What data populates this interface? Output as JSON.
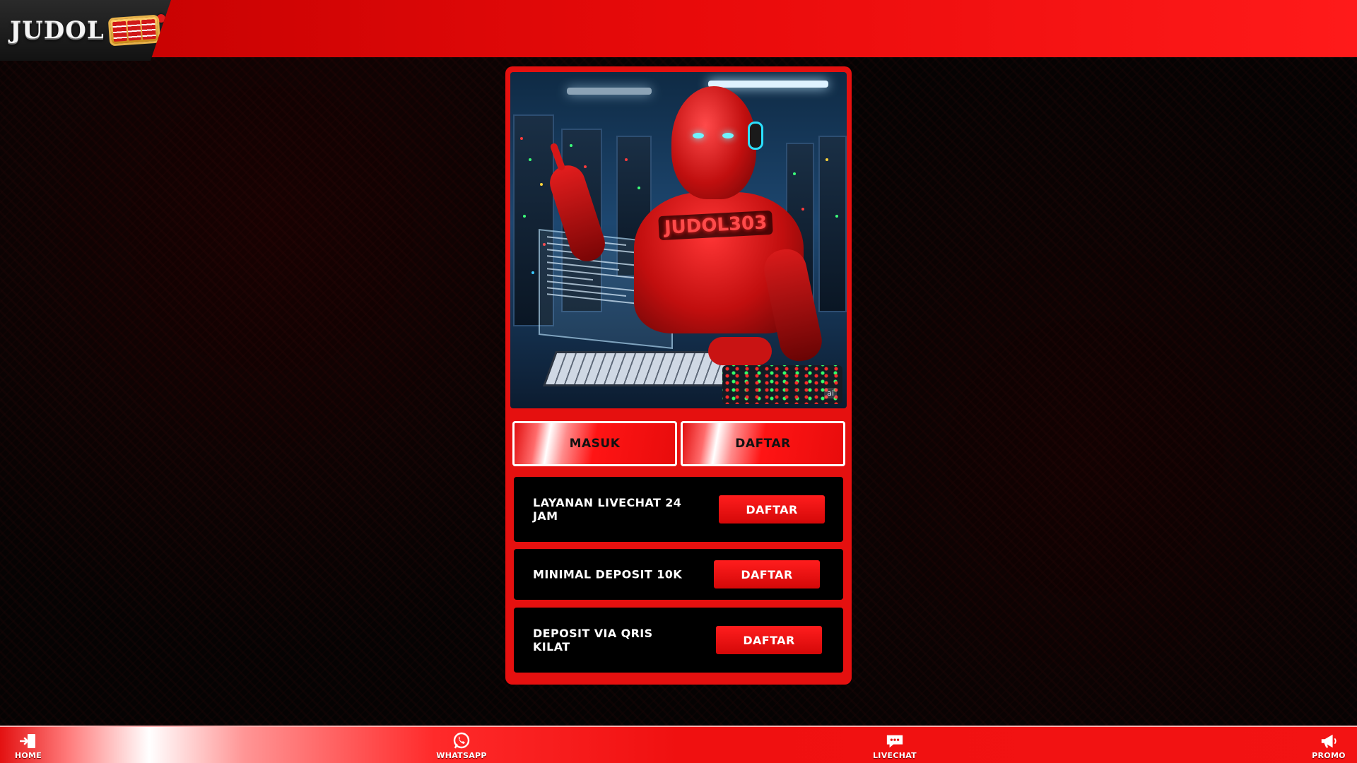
{
  "header": {
    "logo_text": "JUDOL"
  },
  "hero": {
    "robot_label": "JUDOL303",
    "watermark": "ai"
  },
  "tabs": {
    "masuk_label": "MASUK",
    "daftar_label": "DAFTAR"
  },
  "promos": [
    {
      "label": "LAYANAN LIVECHAT 24 JAM",
      "button": "DAFTAR"
    },
    {
      "label": "MINIMAL DEPOSIT 10K",
      "button": "DAFTAR"
    },
    {
      "label": "DEPOSIT VIA QRIS KILAT",
      "button": "DAFTAR"
    }
  ],
  "bottom_nav": [
    {
      "label": "HOME",
      "icon": "login-door-icon"
    },
    {
      "label": "WHATSAPP",
      "icon": "whatsapp-icon"
    },
    {
      "label": "LIVECHAT",
      "icon": "chat-bubble-icon"
    },
    {
      "label": "PROMO",
      "icon": "megaphone-icon"
    }
  ],
  "colors": {
    "brand_red": "#e5100f",
    "header_red": "#e80a0a",
    "row_background": "#000000",
    "page_background": "#050303"
  }
}
